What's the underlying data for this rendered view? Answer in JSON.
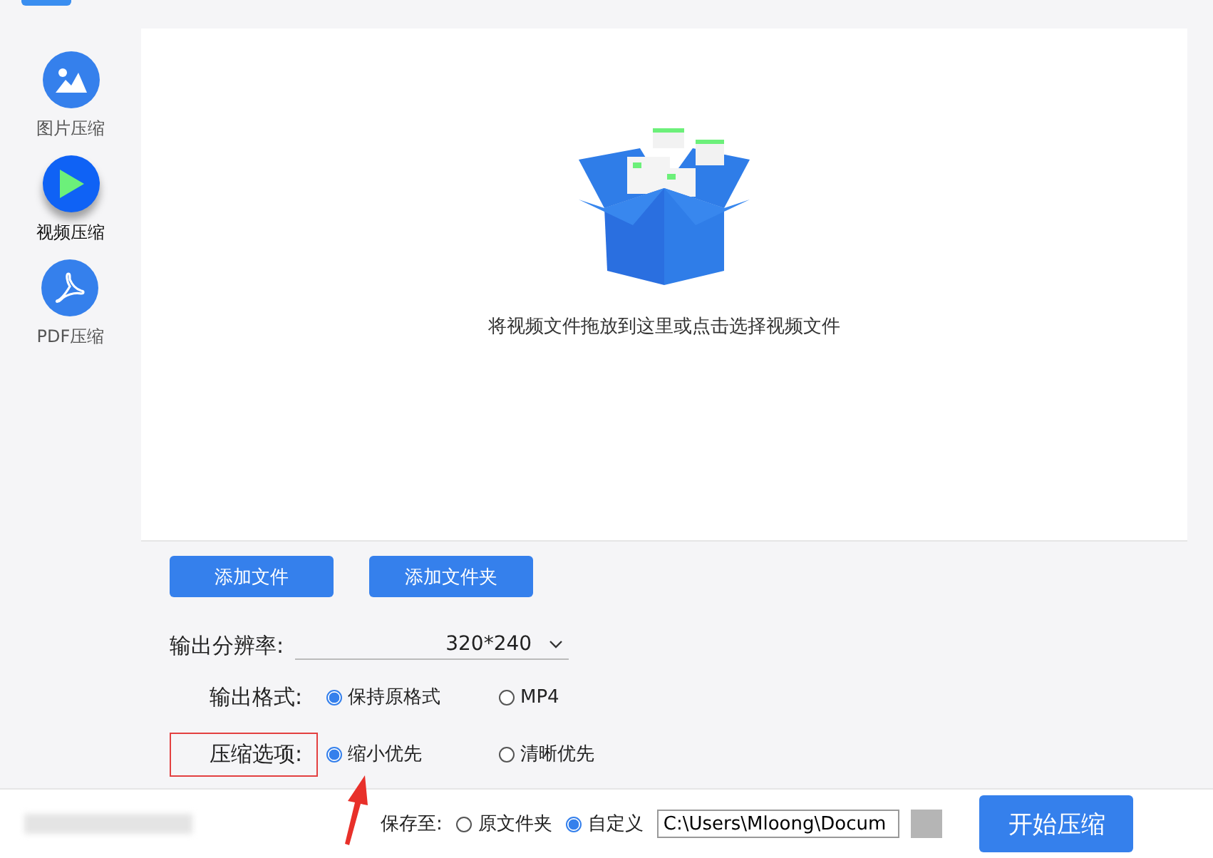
{
  "sidebar": {
    "items": [
      {
        "kind": "image",
        "label": "图片压缩",
        "selected": false
      },
      {
        "kind": "video",
        "label": "视频压缩",
        "selected": true
      },
      {
        "kind": "pdf",
        "label": "PDF压缩",
        "selected": false
      }
    ]
  },
  "drop_zone": {
    "hint": "将视频文件拖放到这里或点击选择视频文件"
  },
  "add_buttons": [
    "添加文件",
    "添加文件夹"
  ],
  "resolution": {
    "label": "输出分辨率:",
    "value": "320*240"
  },
  "options": [
    {
      "label": "输出格式:",
      "highlighted": false,
      "choices": [
        {
          "label": "保持原格式",
          "selected": true
        },
        {
          "label": "MP4",
          "selected": false
        }
      ]
    },
    {
      "label": "压缩选项:",
      "highlighted": true,
      "choices": [
        {
          "label": "缩小优先",
          "selected": true
        },
        {
          "label": "清晰优先",
          "selected": false
        }
      ]
    }
  ],
  "save_to": {
    "label": "保存至:",
    "choices": [
      {
        "label": "原文件夹",
        "selected": false
      },
      {
        "label": "自定义",
        "selected": true
      }
    ],
    "path": "C:\\Users\\Mloong\\Docum"
  },
  "start_button": "开始压缩"
}
